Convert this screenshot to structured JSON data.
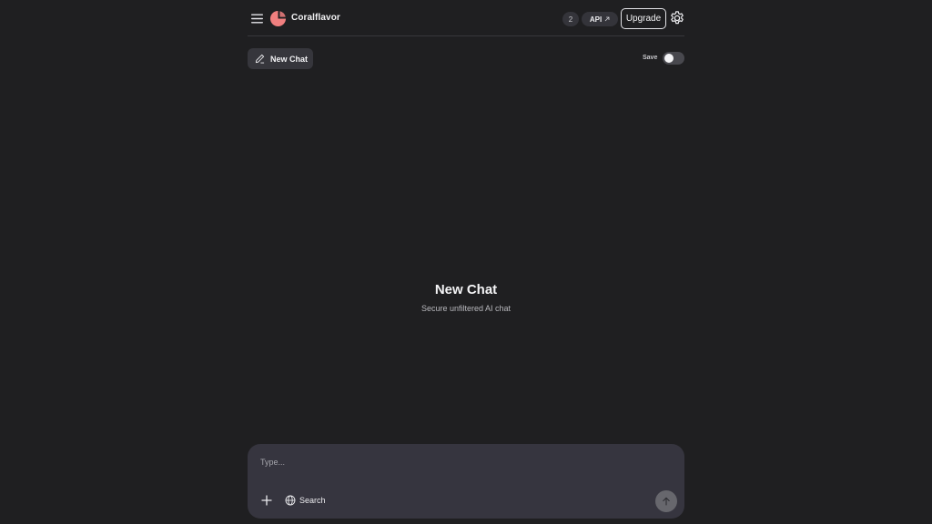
{
  "header": {
    "brand": "Coralflavor",
    "count_badge": "2",
    "api_label": "API",
    "upgrade_label": "Upgrade"
  },
  "toolbar": {
    "new_chat_label": "New Chat",
    "save_label": "Save",
    "save_enabled": false
  },
  "main": {
    "title": "New Chat",
    "subtitle": "Secure unfiltered AI chat"
  },
  "composer": {
    "placeholder": "Type...",
    "value": "",
    "search_label": "Search"
  },
  "icons": {
    "menu": "menu-icon",
    "logo": "coral-logo",
    "api_external": "arrow-up-right-icon",
    "settings": "gear-icon",
    "new_chat": "pencil-icon",
    "attach": "plus-icon",
    "search": "globe-icon",
    "send": "arrow-up-icon"
  },
  "colors": {
    "background": "#1f1f21",
    "brand_logo": "#f07f7f",
    "composer_bg": "#36353f",
    "send_button": "#67676d"
  }
}
